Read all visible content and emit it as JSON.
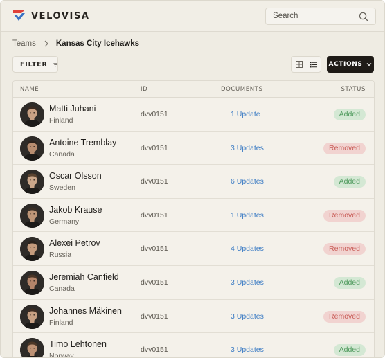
{
  "brand": {
    "name": "VELOVISA",
    "colors": {
      "red": "#e0413a",
      "blue": "#3a72c4"
    }
  },
  "search": {
    "placeholder": "Search"
  },
  "breadcrumb": {
    "root": "Teams",
    "current": "Kansas City Icehawks"
  },
  "toolbar": {
    "filter_label": "FILTER",
    "actions_label": "ACTIONS",
    "view_mode": "list"
  },
  "table": {
    "headers": {
      "name": "NAME",
      "id": "ID",
      "documents": "DOCUMENTS",
      "status": "STATUS"
    },
    "rows": [
      {
        "name": "Matti Juhani",
        "country": "Finland",
        "id": "dvv0151",
        "documents": "1 Update",
        "status": "Added"
      },
      {
        "name": "Antoine Tremblay",
        "country": "Canada",
        "id": "dvv0151",
        "documents": "3 Updates",
        "status": "Removed"
      },
      {
        "name": "Oscar Olsson",
        "country": "Sweden",
        "id": "dvv0151",
        "documents": "6 Updates",
        "status": "Added"
      },
      {
        "name": "Jakob Krause",
        "country": "Germany",
        "id": "dvv0151",
        "documents": "1 Updates",
        "status": "Removed"
      },
      {
        "name": "Alexei Petrov",
        "country": "Russia",
        "id": "dvv0151",
        "documents": "4 Updates",
        "status": "Removed"
      },
      {
        "name": "Jeremiah Canfield",
        "country": "Canada",
        "id": "dvv0151",
        "documents": "3 Updates",
        "status": "Added"
      },
      {
        "name": "Johannes Mäkinen",
        "country": "Finland",
        "id": "dvv0151",
        "documents": "3 Updates",
        "status": "Removed"
      },
      {
        "name": "Timo Lehtonen",
        "country": "Norway",
        "id": "dvv0151",
        "documents": "3 Updates",
        "status": "Added"
      }
    ]
  }
}
